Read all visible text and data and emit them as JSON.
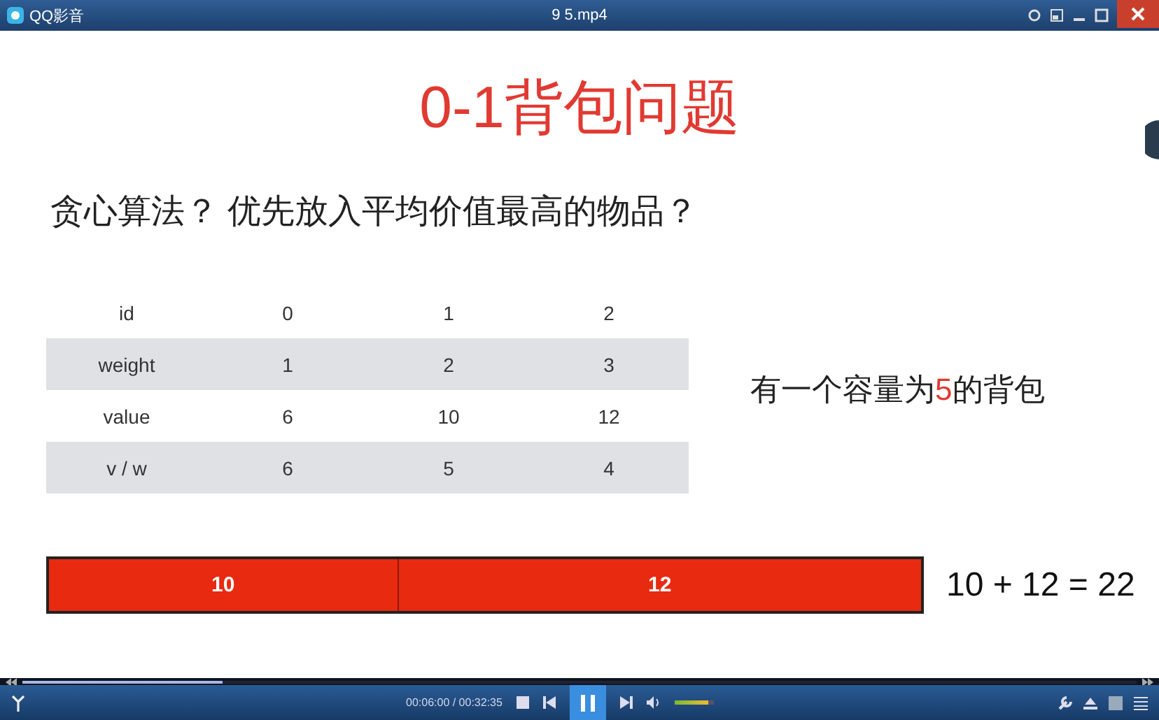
{
  "window": {
    "app_name": "QQ影音",
    "title": "9 5.mp4"
  },
  "slide": {
    "title": "0-1背包问题",
    "subtitle": "贪心算法？ 优先放入平均价值最高的物品？",
    "table": {
      "rows": [
        {
          "shaded": false,
          "cells": [
            "id",
            "0",
            "1",
            "2"
          ]
        },
        {
          "shaded": true,
          "cells": [
            "weight",
            "1",
            "2",
            "3"
          ]
        },
        {
          "shaded": false,
          "cells": [
            "value",
            "6",
            "10",
            "12"
          ]
        },
        {
          "shaded": true,
          "cells": [
            "v / w",
            "6",
            "5",
            "4"
          ]
        }
      ]
    },
    "note_parts": [
      {
        "text": "有一个容量为",
        "highlight": false
      },
      {
        "text": "5",
        "highlight": true
      },
      {
        "text": "的背包",
        "highlight": false
      }
    ],
    "bag_segments": [
      {
        "label": "10",
        "level": 0.4
      },
      {
        "label": "12",
        "level": 0.6
      }
    ],
    "equation": "10 + 12 = 22"
  },
  "player": {
    "progress": {
      "level": 0.18
    },
    "time": "00:06:00 / 00:32:35",
    "playing": true,
    "volume": {
      "level": 0.85
    }
  }
}
